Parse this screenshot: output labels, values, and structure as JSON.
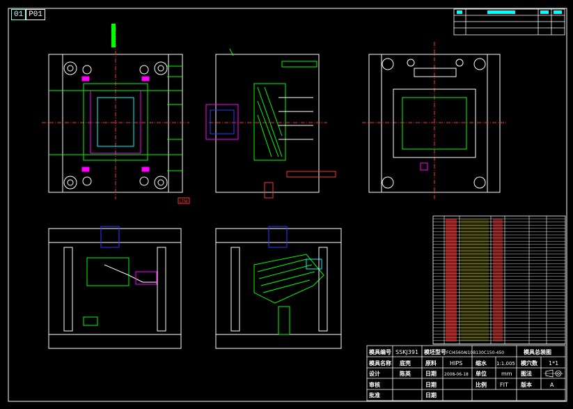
{
  "tabs": [
    {
      "label": "01"
    },
    {
      "label": "P01"
    }
  ],
  "marker_red_label": "LTM",
  "title_block": {
    "r1": {
      "mold_no_label": "模具编号",
      "mold_no": "SSKJ391",
      "model_label": "模坯型号",
      "model": "FCI4560AI10B130C150-450",
      "drawing_name": "模具总装图"
    },
    "r2": {
      "mold_name_label": "模具名称",
      "mold_name": "底壳",
      "material_label": "原料",
      "material": "HIPS",
      "shrink_label": "缩水",
      "shrink": "1:1.005",
      "cavity_label": "模穴数",
      "cavity": "1*1"
    },
    "r3": {
      "design_label": "设计",
      "designer": "陈英",
      "date_label": "日期",
      "date": "2008-06-18",
      "unit_label": "单位",
      "unit": "mm",
      "method_label": "图法"
    },
    "r4": {
      "review_label": "审核",
      "date_label": "日期",
      "scale_label": "比例",
      "scale": "FIT",
      "version_label": "版本",
      "version": "A"
    },
    "r5": {
      "approve_label": "批准",
      "date_label": "日期"
    }
  },
  "colors": {
    "background": "#000000",
    "frame": "#ffffff",
    "outline": "#ffffff",
    "hatch_green": "#00ff00",
    "magenta": "#ff00ff",
    "red": "#ff3030",
    "cyan": "#00ffff",
    "blue": "#3050ff",
    "yellow": "#ffff00"
  }
}
